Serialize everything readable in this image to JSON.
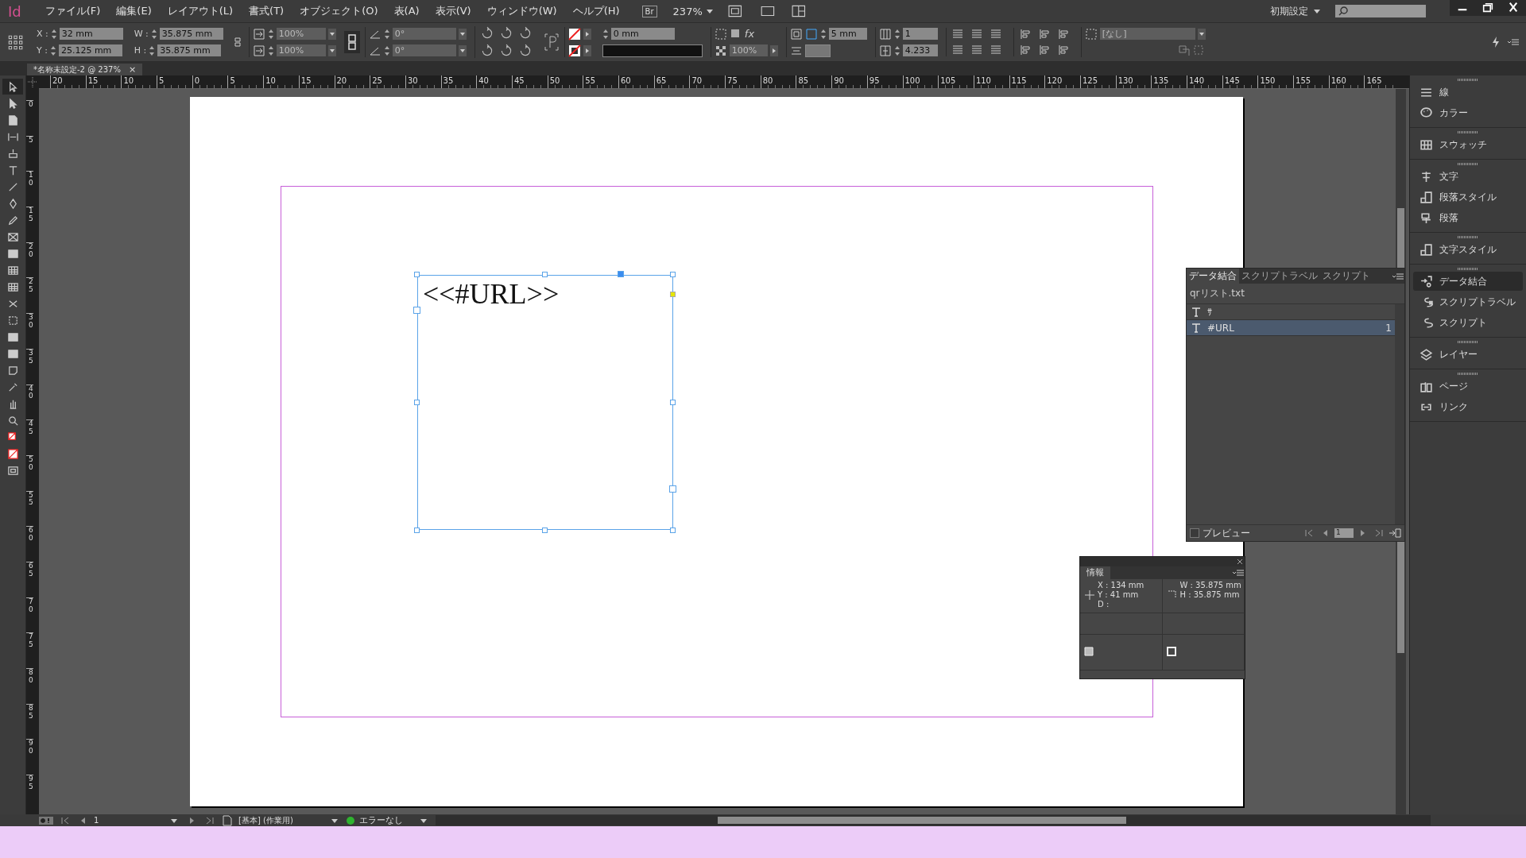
{
  "app_logo": "Id",
  "menu": [
    "ファイル(F)",
    "編集(E)",
    "レイアウト(L)",
    "書式(T)",
    "オブジェクト(O)",
    "表(A)",
    "表示(V)",
    "ウィンドウ(W)",
    "ヘルプ(H)"
  ],
  "bridge_button": "Br",
  "zoom": "237%",
  "workspace": "初期設定",
  "control_panel": {
    "position": [
      {
        "label": "X :",
        "value": "32 mm"
      },
      {
        "label": "Y :",
        "value": "25.125 mm"
      }
    ],
    "size": [
      {
        "label": "W :",
        "value": "35.875 mm"
      },
      {
        "label": "H :",
        "value": "35.875 mm"
      }
    ],
    "scale": [
      "100%",
      "100%"
    ],
    "angles": [
      "0°",
      "0°"
    ],
    "stroke_weight": "0 mm",
    "effects_label": "fx",
    "opacity": "100%",
    "offset": "5 mm",
    "columns": "1",
    "gutter": "4.233",
    "object_style": "[なし]"
  },
  "document_tab": {
    "title": "*名称未設定-2 @ 237%",
    "close": "×"
  },
  "hruler_labels": [
    "20",
    "15",
    "10",
    "5",
    "0",
    "5",
    "10",
    "15",
    "20",
    "25",
    "30",
    "35",
    "40",
    "45",
    "50",
    "55",
    "60",
    "65",
    "70",
    "75",
    "80",
    "85",
    "90",
    "95",
    "100",
    "105",
    "110",
    "115",
    "120",
    "125",
    "130",
    "135",
    "140",
    "145",
    "150",
    "155",
    "160",
    "165"
  ],
  "vruler_labels": [
    "0",
    "5",
    "10",
    "15",
    "20",
    "25",
    "30",
    "35",
    "40",
    "45",
    "50",
    "55",
    "60",
    "65",
    "70",
    "75",
    "80",
    "85",
    "90",
    "95"
  ],
  "tools": [
    {
      "kind": "selection",
      "selected": true
    },
    {
      "kind": "direct",
      "selected": false
    },
    {
      "kind": "page",
      "selected": false
    },
    {
      "kind": "gap",
      "selected": false
    },
    {
      "kind": "collector",
      "selected": false
    },
    {
      "kind": "type",
      "selected": false
    },
    {
      "kind": "line",
      "selected": false
    },
    {
      "kind": "pen",
      "selected": false
    },
    {
      "kind": "pencil",
      "selected": false
    },
    {
      "kind": "frame",
      "selected": false
    },
    {
      "kind": "rect",
      "selected": false
    },
    {
      "kind": "table",
      "selected": false
    },
    {
      "kind": "table",
      "selected": false
    },
    {
      "kind": "scissors",
      "selected": false
    },
    {
      "kind": "transform",
      "selected": false
    },
    {
      "kind": "gradient",
      "selected": false
    },
    {
      "kind": "gradient",
      "selected": false
    },
    {
      "kind": "note",
      "selected": false
    },
    {
      "kind": "eyedropper",
      "selected": false
    },
    {
      "kind": "hand",
      "selected": false
    },
    {
      "kind": "zoom",
      "selected": false
    },
    {
      "kind": "fillstroke",
      "selected": false
    },
    {
      "kind": "none",
      "selected": false
    },
    {
      "kind": "screen",
      "selected": false
    }
  ],
  "frame_text": "<<#URL>>",
  "dock_groups": [
    [
      {
        "kind": "stroke",
        "label": "線",
        "selected": false
      },
      {
        "kind": "color",
        "label": "カラー",
        "selected": false
      }
    ],
    [
      {
        "kind": "swatches",
        "label": "スウォッチ",
        "selected": false
      }
    ],
    [
      {
        "kind": "character",
        "label": "文字",
        "selected": false
      },
      {
        "kind": "parastyle",
        "label": "段落スタイル",
        "selected": false
      },
      {
        "kind": "paragraph",
        "label": "段落",
        "selected": false
      }
    ],
    [
      {
        "kind": "charstyle",
        "label": "文字スタイル",
        "selected": false
      }
    ],
    [
      {
        "kind": "merge",
        "label": "データ結合",
        "selected": true
      },
      {
        "kind": "scriptlabel",
        "label": "スクリプトラベル",
        "selected": false
      },
      {
        "kind": "script",
        "label": "スクリプト",
        "selected": false
      }
    ],
    [
      {
        "kind": "layers",
        "label": "レイヤー",
        "selected": false
      }
    ],
    [
      {
        "kind": "pages",
        "label": "ページ",
        "selected": false
      },
      {
        "kind": "links",
        "label": "リンク",
        "selected": false
      }
    ]
  ],
  "data_merge": {
    "tabs": [
      {
        "label": "データ結合",
        "selected": true
      },
      {
        "label": "スクリプトラベル",
        "selected": false
      },
      {
        "label": "スクリプト",
        "selected": false
      }
    ],
    "source": "qrリスト.txt",
    "fields": [
      {
        "name": "ｻ",
        "selected": false
      },
      {
        "name": "#URL",
        "count": "1",
        "selected": true
      }
    ],
    "preview": {
      "label": "プレビュー",
      "checked": false
    },
    "record": "1"
  },
  "info": {
    "title": "情報",
    "left": [
      "X : 134 mm",
      "Y : 41 mm",
      "D :"
    ],
    "right": [
      "W : 35.875 mm",
      "H : 35.875 mm"
    ]
  },
  "status_bar": {
    "page": "1",
    "profile": "[基本] (作業用)",
    "preflight": "エラーなし"
  }
}
